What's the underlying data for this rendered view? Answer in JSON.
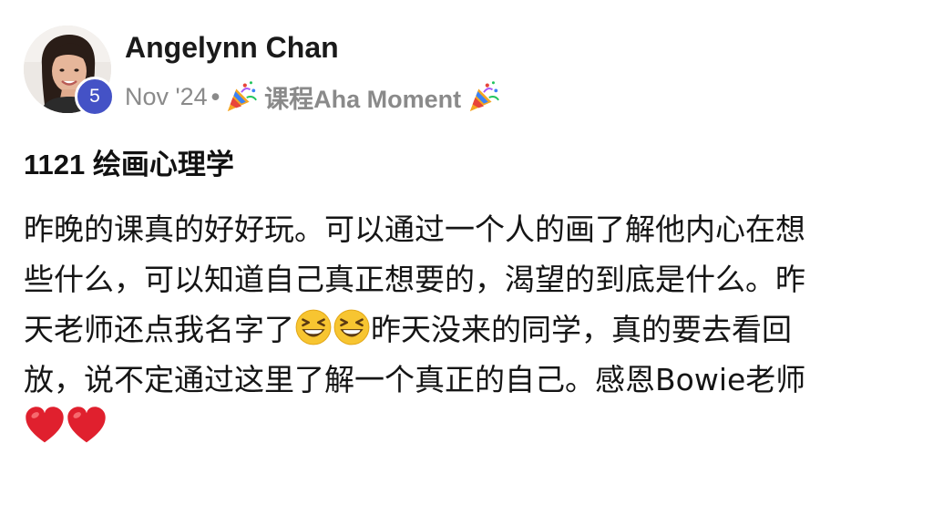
{
  "post": {
    "author": {
      "name": "Angelynn Chan",
      "level": "5"
    },
    "meta": {
      "date": "Nov '24",
      "separator": "•",
      "category": "课程Aha Moment",
      "category_icon": "party-popper-icon"
    },
    "title": "1121 绘画心理学",
    "body": {
      "line1": "昨晚的课真的好好玩。可以通过一个人的画了解他内心在想",
      "line2": "些什么，可以知道自己真正想要的，渴望的到底是什么。昨",
      "line3_a": "天老师还点我名字了",
      "line3_b": "昨天没来的同学，真的要去看回",
      "line4": "放，说不定通过这里了解一个真正的自己。感恩Bowie老师",
      "emoji_laughing": "grinning-squinting-face-icon",
      "emoji_heart": "red-heart-icon"
    },
    "colors": {
      "badge": "#4452c6",
      "meta_text": "#8a8a8a",
      "heart": "#e0202e",
      "emoji_face": "#f7c531"
    }
  }
}
